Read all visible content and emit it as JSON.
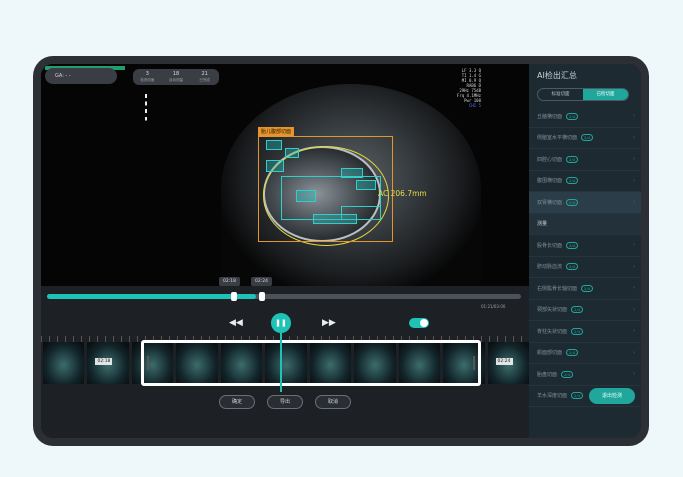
{
  "info": {
    "label": "GA: - -"
  },
  "counters": [
    {
      "value": "3",
      "label": "检测切面"
    },
    {
      "value": "18",
      "label": "自动测量"
    },
    {
      "value": "21",
      "label": "已完成"
    }
  ],
  "params": [
    "LF 3.3 Q",
    "TI 1.4 G",
    "MI 0.9 Q",
    "RAB6 D",
    "29Hz 75dB",
    "Frq 4.1MHz",
    "Pwr 100",
    "CHI 5"
  ],
  "overlay": {
    "organ_label": "胎儿腹部切面",
    "measurement": "AC 206.7mm"
  },
  "playback": {
    "progress_pct": 44,
    "time_start": "02:18",
    "time_end": "02:24",
    "duration": "01:21/03:00",
    "progress_marker": "02:18"
  },
  "frames": [
    "",
    "02:18",
    "",
    "",
    "",
    "",
    "",
    "",
    "",
    "",
    "02:24"
  ],
  "buttons": [
    "确定",
    "导出",
    "取消"
  ],
  "sidebar": {
    "title": "AI检出汇总",
    "tabs": [
      "标准切面",
      "已检切面"
    ],
    "items": [
      {
        "label": "丘脑横切面",
        "badge": "2/4"
      },
      {
        "label": "侧脑室水平横切面",
        "badge": "2/4"
      },
      {
        "label": "四腔心切面",
        "badge": "2/4"
      },
      {
        "label": "腹围横切面",
        "badge": "2/4"
      },
      {
        "label": "双肾横切面",
        "badge": "2/4"
      },
      {
        "label": "测量",
        "badge": ""
      },
      {
        "label": "股骨长切面",
        "badge": "2/4"
      },
      {
        "label": "脐动脉血流",
        "badge": "2/4"
      },
      {
        "label": "右侧肱骨长轴切面",
        "badge": "2/4"
      },
      {
        "label": "颈部矢状切面",
        "badge": "2/4"
      },
      {
        "label": "脊柱矢状切面",
        "badge": "2/4"
      },
      {
        "label": "颜面部切面",
        "badge": "2/4"
      },
      {
        "label": "胎盘切面",
        "badge": "2/4"
      },
      {
        "label": "羊水深度切面",
        "badge": "2/4"
      }
    ],
    "fab": "退出检测"
  },
  "colors": {
    "accent": "#1fc3b6",
    "box": "#e5952b",
    "detect": "#2ed1c9",
    "ellipse": "#e2d63a"
  }
}
